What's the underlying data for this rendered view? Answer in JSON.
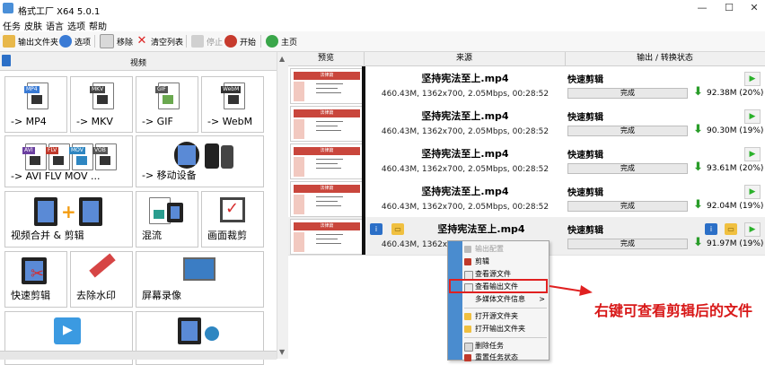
{
  "window": {
    "title": "格式工厂 X64 5.0.1",
    "minimize": "—",
    "maximize": "☐",
    "close": "✕"
  },
  "menu": [
    "任务",
    "皮肤",
    "语言",
    "选项",
    "帮助"
  ],
  "toolbar": {
    "output_folder": "输出文件夹",
    "options": "选项",
    "remove": "移除",
    "clear_list": "清空列表",
    "stop": "停止",
    "start": "开始",
    "home": "主页"
  },
  "left": {
    "category": "视频",
    "tiles": [
      {
        "label": "-> MP4",
        "tag": "MP4",
        "tag_color": "#3a7bd5"
      },
      {
        "label": "-> MKV",
        "tag": "MKV",
        "tag_color": "#444444"
      },
      {
        "label": "-> GIF",
        "tag": "GIF",
        "tag_color": "#555555"
      },
      {
        "label": "-> WebM",
        "tag": "WebM",
        "tag_color": "#333333"
      },
      {
        "label": "-> AVI FLV MOV ...",
        "tags": [
          "AVI",
          "FLV",
          "MOV",
          "VOB"
        ]
      },
      {
        "label": "-> 移动设备"
      },
      {
        "label": "视频合并 & 剪辑"
      },
      {
        "label": "混流"
      },
      {
        "label": "画面裁剪"
      },
      {
        "label": "快速剪辑"
      },
      {
        "label": "去除水印"
      },
      {
        "label": "屏幕录像"
      },
      {
        "label": ""
      },
      {
        "label": ""
      }
    ]
  },
  "table": {
    "headers": [
      "预览",
      "来源",
      "输出 / 转换状态"
    ],
    "rows": [
      {
        "name": "坚持宪法至上.mp4",
        "info": "460.43M, 1362x700, 2.05Mbps, 00:28:52",
        "mode": "快速剪辑",
        "status": "完成",
        "size": "92.38M",
        "pct": "(20%)"
      },
      {
        "name": "坚持宪法至上.mp4",
        "info": "460.43M, 1362x700, 2.05Mbps, 00:28:52",
        "mode": "快速剪辑",
        "status": "完成",
        "size": "90.30M",
        "pct": "(19%)"
      },
      {
        "name": "坚持宪法至上.mp4",
        "info": "460.43M, 1362x700, 2.05Mbps, 00:28:52",
        "mode": "快速剪辑",
        "status": "完成",
        "size": "93.61M",
        "pct": "(20%)"
      },
      {
        "name": "坚持宪法至上.mp4",
        "info": "460.43M, 1362x700, 2.05Mbps, 00:28:52",
        "mode": "快速剪辑",
        "status": "完成",
        "size": "92.04M",
        "pct": "(19%)"
      },
      {
        "name": "坚持宪法至上.mp4",
        "info": "460.43M, 1362x700, 2.05Mbps, 00:28:52",
        "mode": "快速剪辑",
        "status": "完成",
        "size": "91.97M",
        "pct": "(19%)"
      }
    ],
    "thumb_title": "法律篇"
  },
  "context_menu": {
    "items": [
      "输出配置",
      "剪辑",
      "查看源文件",
      "查看输出文件",
      "多媒体文件信息",
      "打开源文件夹",
      "打开输出文件夹",
      "删除任务",
      "重置任务状态"
    ],
    "submenu_arrow": ">"
  },
  "annotation": {
    "text": "右键可查看剪辑后的文件",
    "color": "#d81818"
  }
}
